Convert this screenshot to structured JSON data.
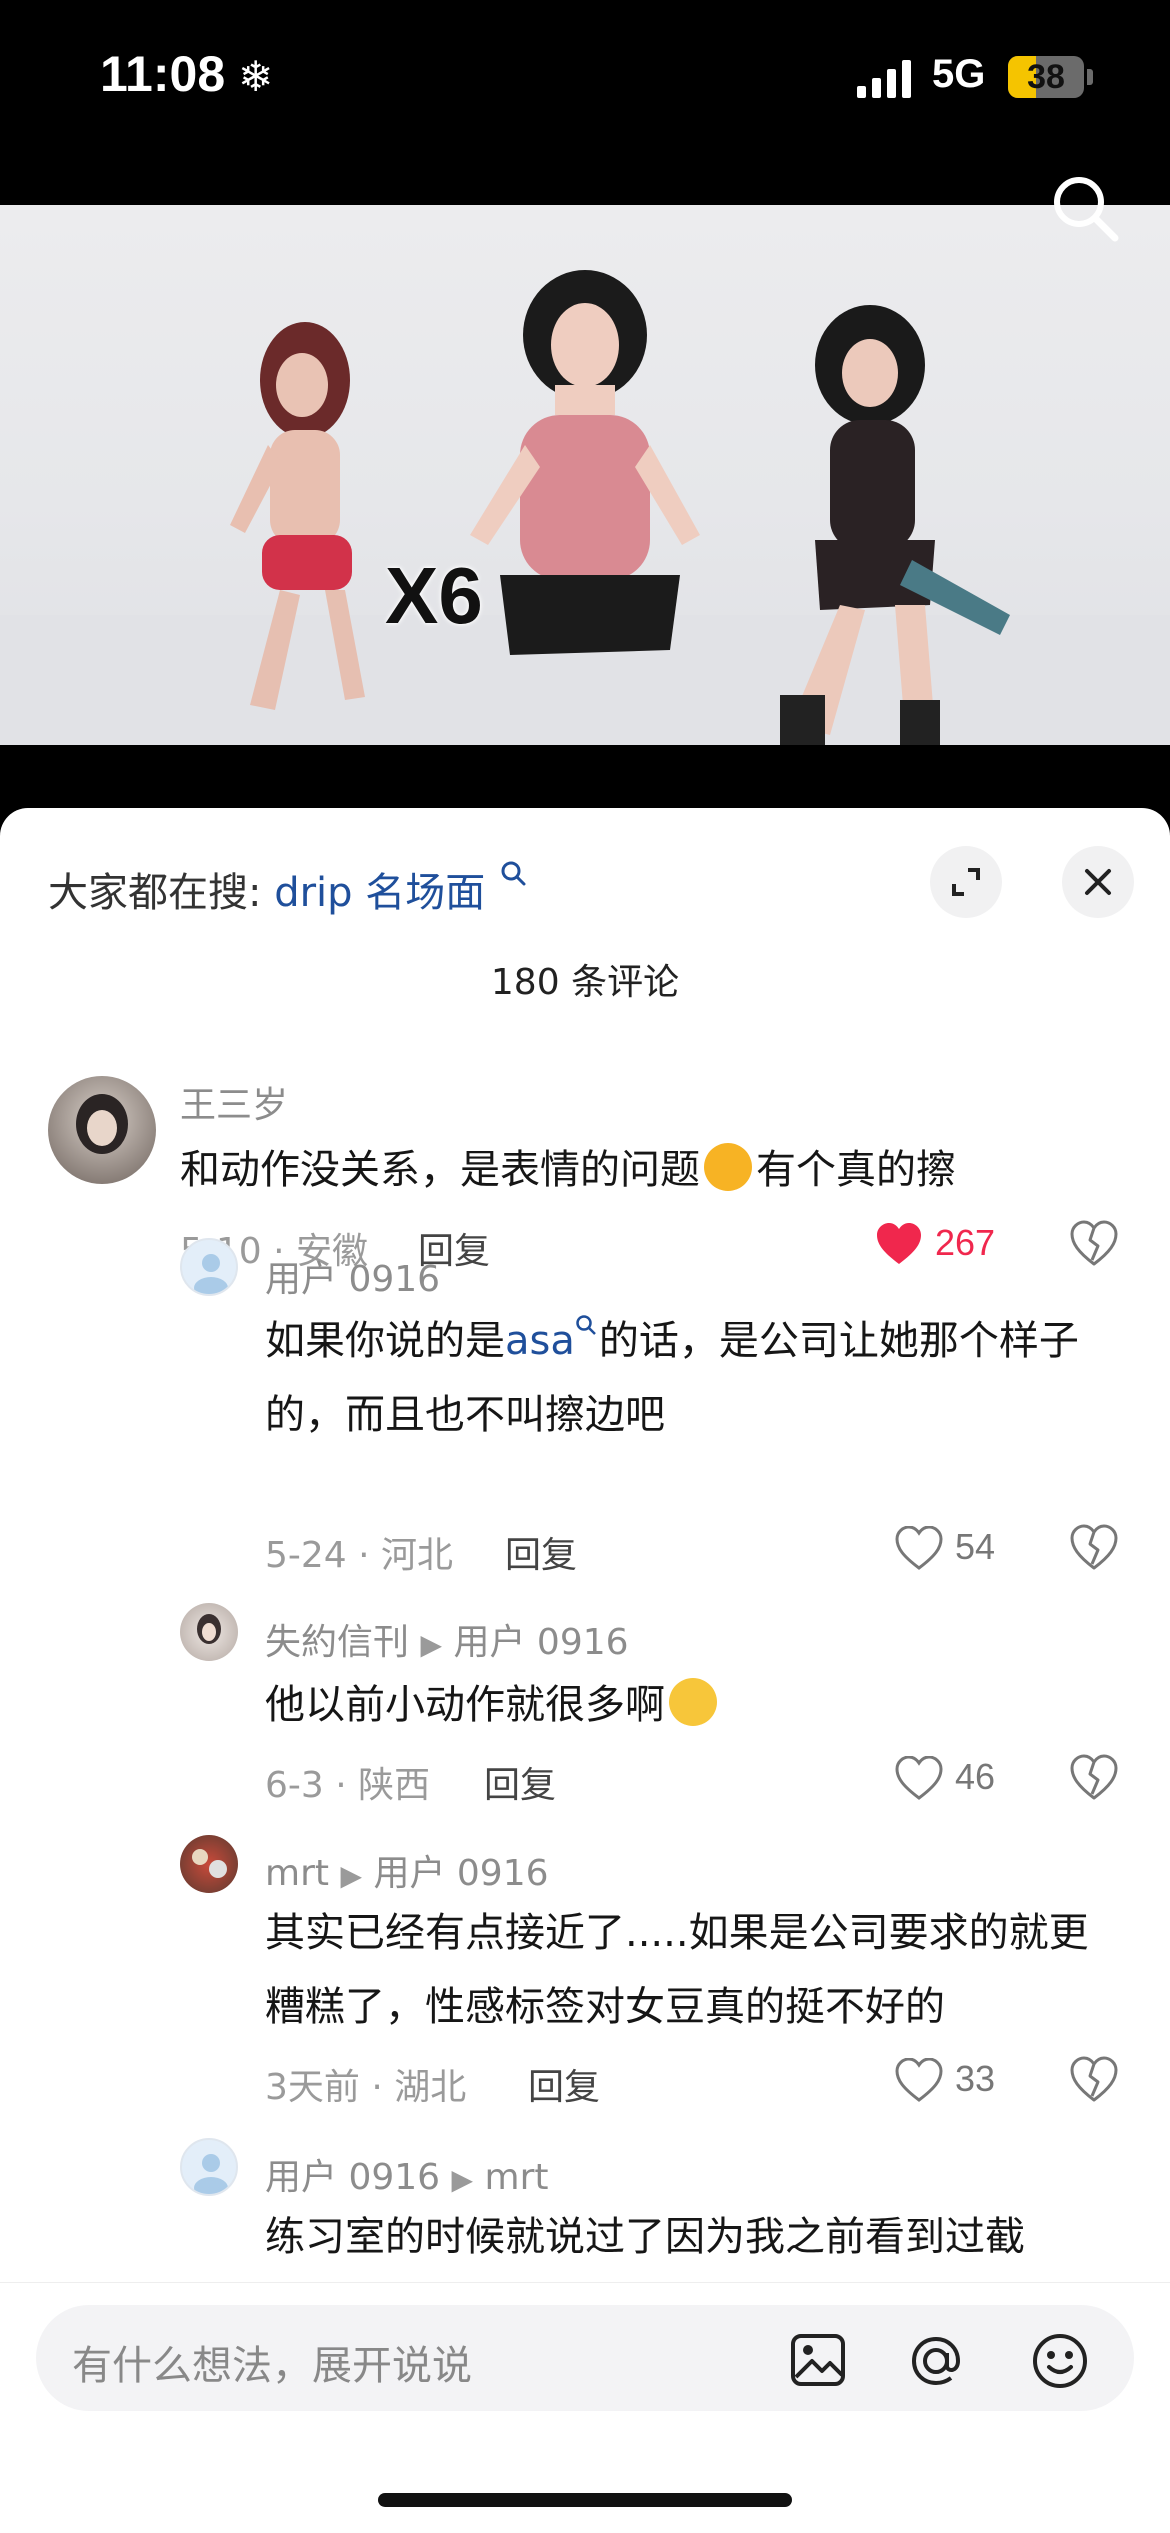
{
  "status": {
    "time": "11:08",
    "network": "5G",
    "battery": "38"
  },
  "video": {
    "overlay_text": "X6"
  },
  "sheet": {
    "trend_label": "大家都在搜:",
    "trend_keyword": "drip 名场面",
    "comment_count": "180 条评论"
  },
  "comments": [
    {
      "user": "王三岁",
      "text": "和动作没关系，是表情的问题",
      "text_tail": "有个真的擦",
      "date": "5-10 · 安徽",
      "reply": "回复",
      "likes": "267",
      "liked": true
    },
    {
      "user": "用户 0916",
      "text_pre": "如果你说的是",
      "link": "asa",
      "text_post": "的话，是公司让她那个样子的，而且也不叫擦边吧",
      "date": "5-24 · 河北",
      "reply": "回复",
      "likes": "54"
    },
    {
      "user": "失約信刊",
      "reply_to": "用户 0916",
      "text": "他以前小动作就很多啊",
      "date": "6-3 · 陕西",
      "reply": "回复",
      "likes": "46"
    },
    {
      "user": "mrt",
      "reply_to": "用户 0916",
      "text": "其实已经有点接近了.....如果是公司要求的就更糟糕了，性感标签对女豆真的挺不好的",
      "date": "3天前 · 湖北",
      "reply": "回复",
      "likes": "33"
    },
    {
      "user": "用户 0916",
      "reply_to": "mrt",
      "text": "练习室的时候就说过了因为我之前看到过截"
    }
  ],
  "input": {
    "placeholder": "有什么想法，展开说说"
  },
  "colors": {
    "link": "#1f4f9b",
    "like_red": "#f0274d",
    "battery": "#f5c400"
  }
}
